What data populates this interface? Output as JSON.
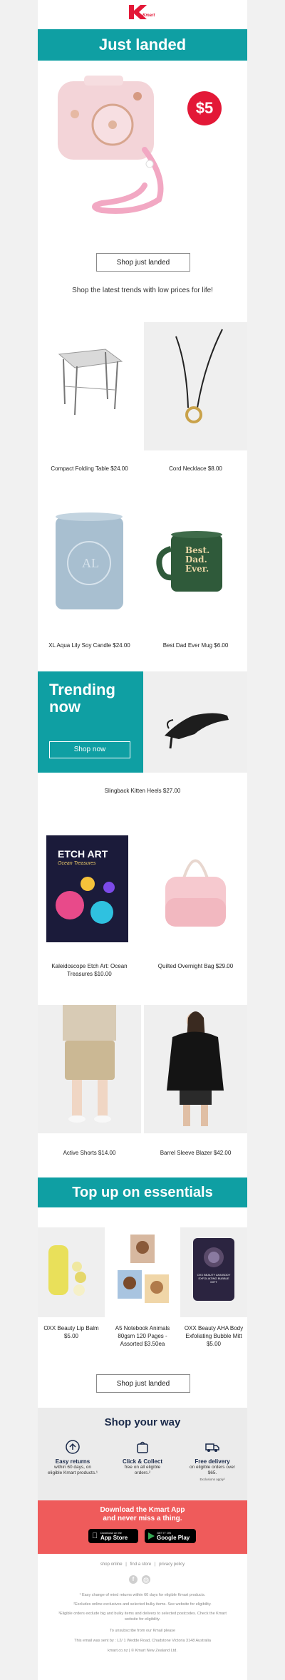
{
  "header": {
    "logo": "Kmart",
    "logo_sub": "Kmart"
  },
  "hero": {
    "title": "Just landed",
    "price_badge": "$5",
    "button": "Shop just landed",
    "tagline": "Shop the latest trends with low prices for life!"
  },
  "products_grid_1": [
    {
      "label": "Compact Folding Table $24.00"
    },
    {
      "label": "Cord Necklace $8.00"
    },
    {
      "label": "XL Aqua Lily Soy Candle $24.00"
    },
    {
      "label": "Best Dad Ever Mug $6.00"
    }
  ],
  "mug_text": [
    "Best.",
    "Dad.",
    "Ever."
  ],
  "trending": {
    "title_line1": "Trending",
    "title_line2": "now",
    "button": "Shop now",
    "feature_label": "Slingback Kitten Heels $27.00"
  },
  "products_grid_2": [
    {
      "label": "Kaleidoscope Etch Art: Ocean Treasures $10.00"
    },
    {
      "label": "Quilted Overnight Bag $29.00"
    },
    {
      "label": "Active Shorts $14.00"
    },
    {
      "label": "Barrel Sleeve Blazer $42.00"
    }
  ],
  "etch_box": {
    "brand": "ETCH ART",
    "sub": "Ocean Treasures"
  },
  "essentials": {
    "title": "Top up on essentials",
    "items": [
      {
        "label": "OXX Beauty Lip Balm $5.00"
      },
      {
        "label": "A5 Notebook Animals 80gsm 120 Pages - Assorted $3.50ea"
      },
      {
        "label": "OXX Beauty AHA Body Exfoliating Bubble Mitt $5.00"
      }
    ],
    "mitt_text": "OXX BEAUTY AHA BODY EXFOLIATING BUBBLE MITT",
    "button": "Shop just landed"
  },
  "shop_your_way": {
    "title": "Shop your way",
    "cols": [
      {
        "title": "Easy returns",
        "text": "within 60 days, on eligible Kmart products.¹"
      },
      {
        "title": "Click & Collect",
        "text": "free on all eligible orders.²"
      },
      {
        "title": "Free delivery",
        "text": "on eligible orders over $65.",
        "note": "Exclusions apply³"
      }
    ]
  },
  "app": {
    "line1": "Download the Kmart App",
    "line2": "and never miss a thing.",
    "appstore_small": "Download on the",
    "appstore": "App Store",
    "gplay_small": "GET IT ON",
    "gplay": "Google Play"
  },
  "footer": {
    "links": [
      "shop online",
      "find a store",
      "privacy policy"
    ],
    "legal1": "¹ Easy change of mind returns within 60 days for eligible Kmart products.",
    "legal2": "²Excludes online exclusives and selected bulky items. See website for eligibility.",
    "legal3": "³Eligible orders exclude big and bulky items and delivery to selected postcodes. Check the Kmart website for eligibility.",
    "unsubscribe": "To unsubscribe from our Kmail please",
    "sent_by": "This email was sent by : L2/ 1 Wedde Road, Chadstone Victoria 3148 Australia",
    "copyright": "kmart.co.nz | © Kmart New Zealand Ltd."
  },
  "colors": {
    "teal": "#0f9fa3",
    "red": "#e31837",
    "coral": "#ef5b5b",
    "navy": "#1b2a4a"
  }
}
